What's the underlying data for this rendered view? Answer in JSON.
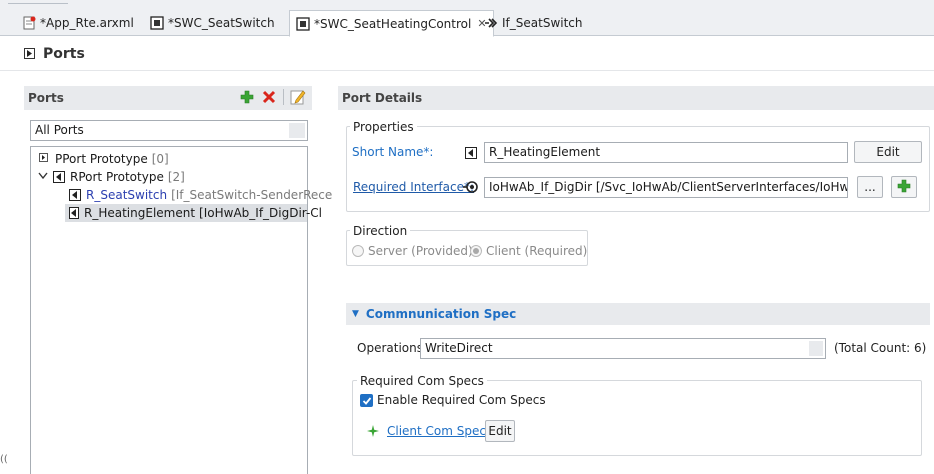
{
  "tabs": [
    {
      "label": "*App_Rte.arxml",
      "icon": "arxml-file-icon",
      "active": false
    },
    {
      "label": "*SWC_SeatSwitch",
      "icon": "component-icon",
      "active": false
    },
    {
      "label": "*SWC_SeatHeatingControl",
      "icon": "component-icon",
      "active": true
    },
    {
      "label": "If_SeatSwitch",
      "icon": "interface-icon",
      "active": false
    }
  ],
  "header": {
    "title": "Ports"
  },
  "ports_panel": {
    "title": "Ports",
    "filter_value": "All Ports",
    "tree": {
      "pport": {
        "label": "PPort Prototype",
        "count": "[0]"
      },
      "rport": {
        "label": "RPort Prototype",
        "count": "[2]"
      },
      "children": [
        {
          "name": "R_SeatSwitch",
          "detail": "[If_SeatSwitch-SenderRece"
        },
        {
          "name": "R_HeatingElement",
          "detail": "[IoHwAb_If_DigDir-Cl"
        }
      ]
    }
  },
  "details": {
    "title": "Port Details",
    "properties_legend": "Properties",
    "short_name_label": "Short Name*:",
    "short_name_value": "R_HeatingElement",
    "edit_label": "Edit",
    "required_interface_label": "Required Interface*:",
    "required_interface_value": "IoHwAb_If_DigDir [/Svc_IoHwAb/ClientServerInterfaces/IoHwAb_If_",
    "browse_label": "...",
    "direction_legend": "Direction",
    "server_label": "Server (Provided)",
    "client_label": "Client (Required)",
    "client_selected": true
  },
  "comm_spec": {
    "title": "Commnunication Spec",
    "operations_label": "Operations",
    "operations_value": "WriteDirect",
    "total_count": "(Total Count: 6)",
    "required_legend": "Required Com Specs",
    "enable_label": "Enable Required Com Specs",
    "enable_checked": true,
    "client_com_spec_label": "Client Com Spec",
    "edit_label": "Edit"
  },
  "colors": {
    "accent": "#1f6fc4",
    "add_green": "#3aa535",
    "delete_red": "#d9261c"
  },
  "edge_text": "(("
}
